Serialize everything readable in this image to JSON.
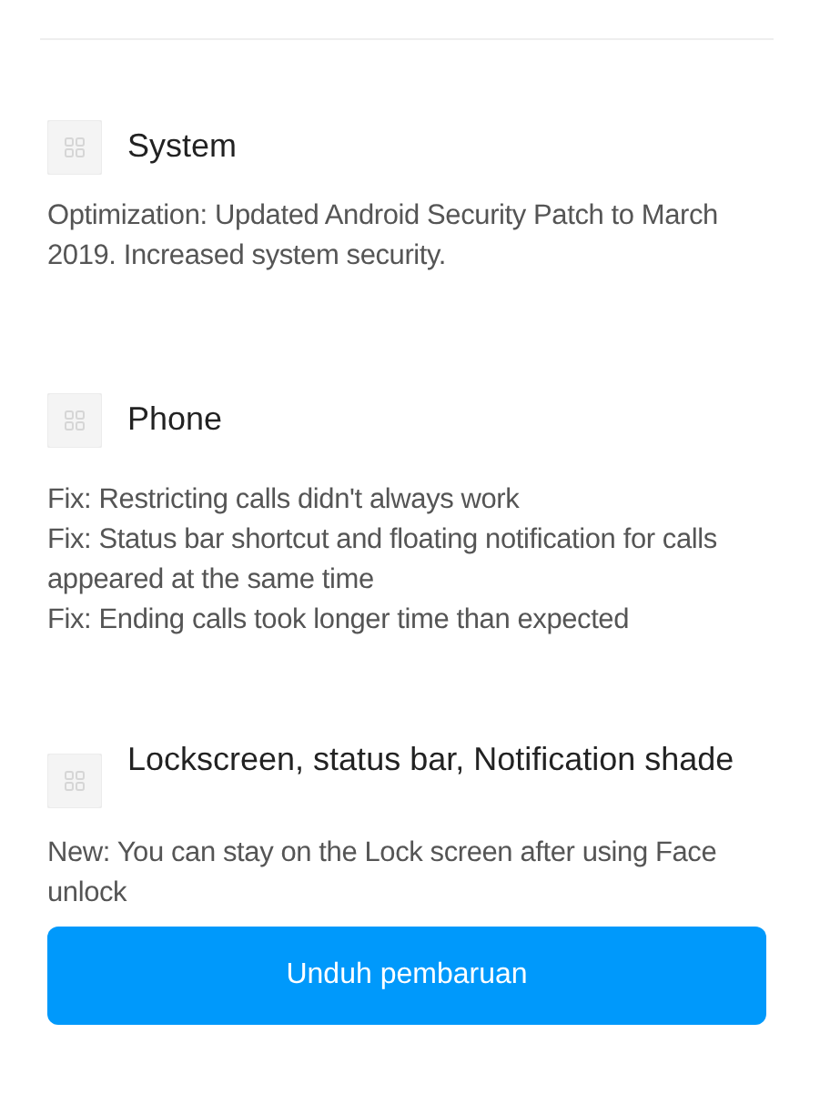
{
  "sections": [
    {
      "title": "System",
      "lines": [
        "Optimization: Updated Android Security Patch to March 2019. Increased system security."
      ]
    },
    {
      "title": "Phone",
      "lines": [
        "Fix: Restricting calls didn't always work",
        "Fix: Status bar shortcut and floating notification for calls appeared at the same time",
        "Fix: Ending calls took longer time than expected"
      ]
    },
    {
      "title": "Lockscreen, status bar, Notification shade",
      "lines": [
        "New: You can stay on the Lock screen after using Face unlock"
      ]
    }
  ],
  "button": "Unduh pembaruan"
}
